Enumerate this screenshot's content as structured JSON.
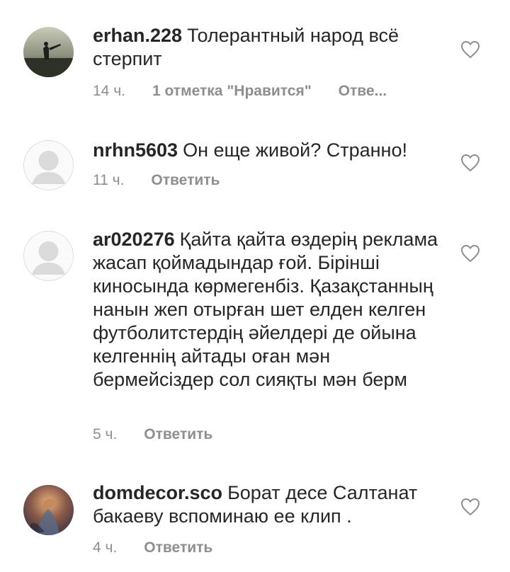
{
  "comments": [
    {
      "username": "erhan.228",
      "text": "Толерантный народ всё стерпит",
      "time": "14 ч.",
      "likes": "1 отметка \"Нравится\"",
      "reply": "Отве..."
    },
    {
      "username": "nrhn5603",
      "text": "Он еще живой? Странно!",
      "time": "11 ч.",
      "reply": "Ответить"
    },
    {
      "username": "ar020276",
      "text": "Қайта қайта өздерің реклама жасап қоймадындар ғой. Бірінші киносында көрмегенбіз. Қазақстанның нанын жеп отырған шет елден келген футболитстердің әйелдері де ойына келгеннің айтады оған мән бермейсіздер сол сияқты мән берм",
      "time": "5 ч.",
      "reply": "Ответить"
    },
    {
      "username": "domdecor.sco",
      "text": "Борат десе Салтанат бакаеву вспоминаю ее клип .",
      "time": "4 ч.",
      "reply": "Ответить"
    }
  ],
  "colors": {
    "text": "#262626",
    "meta": "#8e8e8e",
    "placeholder_avatar": "#dbdbdb"
  },
  "icons": {
    "like": "heart-outline-icon",
    "default_avatar": "default-avatar-icon"
  }
}
